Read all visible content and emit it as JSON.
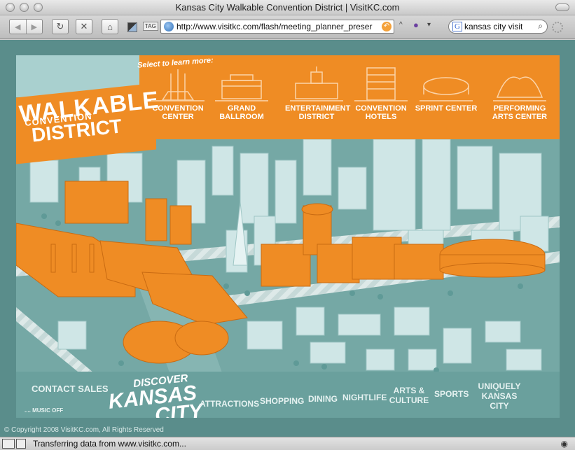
{
  "window": {
    "title": "Kansas City Walkable Convention District | VisitKC.com"
  },
  "toolbar": {
    "address": "http://www.visitkc.com/flash/meeting_planner_preser",
    "search_value": "kansas city visit",
    "icons": [
      "back-icon",
      "forward-icon",
      "reload-icon",
      "stop-icon",
      "home-icon",
      "bookmark-icon",
      "tag-icon"
    ]
  },
  "banner": {
    "select_prompt": "Select to learn more:",
    "walkable": "WALKABLE",
    "convention": "CONVENTION",
    "district": "DISTRICT",
    "venues": [
      {
        "label": "CONVENTION CENTER"
      },
      {
        "label": "GRAND BALLROOM"
      },
      {
        "label": "ENTERTAINMENT DISTRICT"
      },
      {
        "label": "CONVENTION HOTELS"
      },
      {
        "label": "SPRINT CENTER"
      },
      {
        "label": "PERFORMING ARTS CENTER"
      }
    ]
  },
  "footer_nav": {
    "contact": "CONTACT SALES",
    "music": ".... MUSIC OFF",
    "discover": "DISCOVER",
    "kansas": "KANSAS",
    "city": "CITY",
    "links": [
      "ATTRACTIONS",
      "SHOPPING",
      "DINING",
      "NIGHTLIFE",
      "ARTS & CULTURE",
      "SPORTS",
      "UNIQUELY KANSAS CITY"
    ]
  },
  "copyright": "© Copyright 2008 VisitKC.com, All Rights Reserved",
  "status": {
    "text": "Transferring data from www.visitkc.com..."
  },
  "colors": {
    "orange": "#ef8c24",
    "teal": "#6fa3a0",
    "pale": "#cde7e6"
  }
}
